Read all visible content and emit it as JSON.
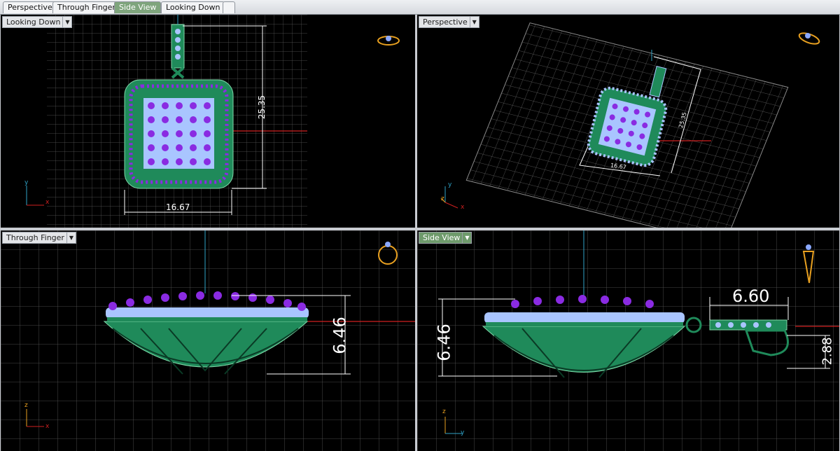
{
  "tabs": [
    {
      "label": "Perspective",
      "active": false
    },
    {
      "label": "Through Finger",
      "active": false
    },
    {
      "label": "Side View",
      "active": true
    },
    {
      "label": "Looking Down",
      "active": false
    },
    {
      "label": "",
      "active": false
    }
  ],
  "viewports": {
    "top_left": {
      "label": "Looking Down",
      "axis_v": "y",
      "axis_h": "x",
      "dim_height": "25.35",
      "dim_width": "16.67"
    },
    "top_right": {
      "label": "Perspective",
      "axis_v": "y",
      "axis_z": "z",
      "axis_h": "x",
      "dim_height": "25.35",
      "dim_width": "16.67"
    },
    "bottom_left": {
      "label": "Through Finger",
      "axis_v": "z",
      "axis_h": "x",
      "dim_height": "6.46"
    },
    "bottom_right": {
      "label": "Side View",
      "axis_v": "z",
      "axis_h": "y",
      "dim_height": "6.46",
      "dim_length": "6.60",
      "dim_bail_height": "2.88"
    }
  },
  "colors": {
    "viewport_bg": "#000000",
    "grid": "#5a5a5a",
    "metal": "#1f8a5a",
    "gem": "#a9c5ff",
    "prong": "#8a2be2",
    "axis_x": "#d02020",
    "axis_y": "#2fa3c8",
    "active_tab": "#7fa57d"
  }
}
